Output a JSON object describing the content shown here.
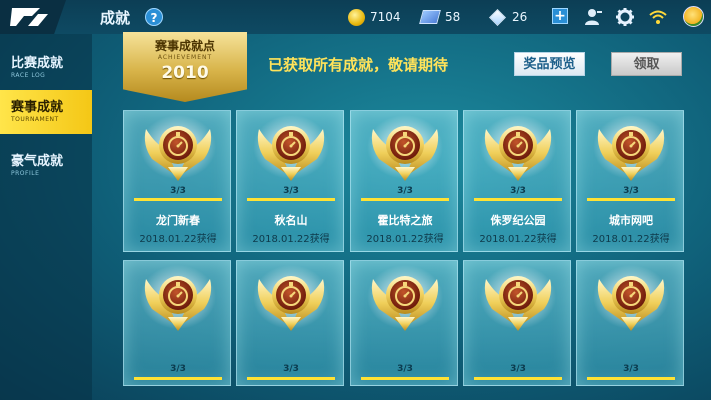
{
  "header": {
    "title": "成就",
    "help_label": "?",
    "coins": "7104",
    "tickets": "58",
    "diamonds": "26",
    "plus_label": "+"
  },
  "sidebar": {
    "items": [
      {
        "label": "比赛成就",
        "sub": "RACE LOG"
      },
      {
        "label": "赛事成就",
        "sub": "TOURNAMENT"
      },
      {
        "label": "豪气成就",
        "sub": "PROFILE"
      }
    ],
    "active_index": 1
  },
  "banner": {
    "ribbon_title": "赛事成就点",
    "ribbon_sub": "ACHIEVEMENT",
    "points": "2010",
    "notice": "已获取所有成就，敬请期待",
    "preview_button": "奖品预览",
    "claim_button": "领取"
  },
  "cards": [
    {
      "progress": "3/3",
      "fill": 1.0,
      "name": "龙门新春",
      "date": "2018.01.22获得"
    },
    {
      "progress": "3/3",
      "fill": 1.0,
      "name": "秋名山",
      "date": "2018.01.22获得"
    },
    {
      "progress": "3/3",
      "fill": 1.0,
      "name": "霍比特之旅",
      "date": "2018.01.22获得"
    },
    {
      "progress": "3/3",
      "fill": 1.0,
      "name": "侏罗纪公园",
      "date": "2018.01.22获得"
    },
    {
      "progress": "3/3",
      "fill": 1.0,
      "name": "城市网吧",
      "date": "2018.01.22获得"
    },
    {
      "progress": "3/3",
      "fill": 1.0
    },
    {
      "progress": "3/3",
      "fill": 1.0
    },
    {
      "progress": "3/3",
      "fill": 1.0
    },
    {
      "progress": "3/3",
      "fill": 1.0
    },
    {
      "progress": "3/3",
      "fill": 1.0
    }
  ],
  "colors": {
    "accent_yellow": "#ffe35a",
    "active_tab": "#f4c716",
    "card_teal": "#5fc4d6"
  },
  "icons": [
    "back-logo-icon",
    "help-icon",
    "coin-icon",
    "ticket-icon",
    "diamond-icon",
    "plus-icon",
    "friends-icon",
    "gear-icon",
    "wifi-icon",
    "avatar",
    "medal-icon"
  ]
}
